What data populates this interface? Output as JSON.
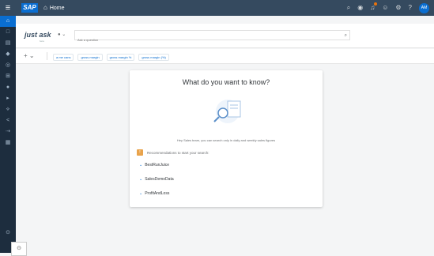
{
  "shell": {
    "logo": "SAP",
    "home_label": "Home",
    "user_initials": "AM"
  },
  "ask": {
    "brand": "just ask",
    "brand_sub": "beta",
    "placeholder": "Ask a question"
  },
  "chips": [
    "a me cans",
    "gross margin",
    "gross margin %",
    "gross margin (%)"
  ],
  "panel": {
    "title": "What do you want to know?",
    "hint": "Hey Sales team, you can search only in daily and weekly sales figures",
    "recommend_label": "Recommendations to start your search:",
    "suggestions": [
      "BestRunJuice",
      "SalesDemoData",
      "ProfitAndLoss"
    ]
  },
  "colors": {
    "shell": "#354a5f",
    "sidebar": "#1d2d3e",
    "accent": "#0a6ed1",
    "recommend_icon": "#e9a34b"
  }
}
